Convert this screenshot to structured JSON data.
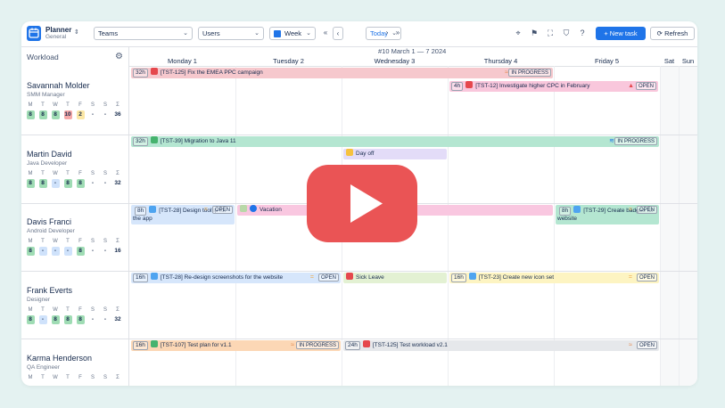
{
  "app": {
    "name": "Planner",
    "sub": "General"
  },
  "toolbar": {
    "teams": "Teams",
    "users": "Users",
    "week": "Week",
    "today": "Today",
    "new_task": "+ New task",
    "refresh": "Refresh"
  },
  "workload_label": "Workload",
  "week_label": "#10 March 1 — 7 2024",
  "days": [
    "Monday 1",
    "Tuesday 2",
    "Wednesday 3",
    "Thursday 4",
    "Friday 5",
    "Sat",
    "Sun"
  ],
  "day_letters": [
    "M",
    "T",
    "W",
    "T",
    "F",
    "S",
    "S",
    "Σ"
  ],
  "people": [
    {
      "name": "Savannah Molder",
      "role": "SMM Manager",
      "values": [
        "8",
        "8",
        "8",
        "10",
        "2",
        "-",
        "-",
        "36"
      ]
    },
    {
      "name": "Martin David",
      "role": "Java Developer",
      "values": [
        "8",
        "8",
        "-",
        "8",
        "8",
        "-",
        "-",
        "32"
      ]
    },
    {
      "name": "Davis Franci",
      "role": "Android Developer",
      "values": [
        "8",
        "-",
        "-",
        "-",
        "8",
        "-",
        "-",
        "16"
      ]
    },
    {
      "name": "Frank Everts",
      "role": "Designer",
      "values": [
        "8",
        "-",
        "8",
        "8",
        "8",
        "-",
        "-",
        "32"
      ]
    },
    {
      "name": "Karma Henderson",
      "role": "QA Engineer",
      "values": [
        "M",
        "T",
        "W",
        "T",
        "F",
        "S",
        "S",
        "Σ"
      ]
    }
  ],
  "tasks": {
    "t1": {
      "est": "32h",
      "text": "[TST-125] Fix the EMEA PPC campaign",
      "status": "IN PROGRESS"
    },
    "t2": {
      "est": "4h",
      "text": "[TST-12] Investigate higher CPC in February",
      "status": "OPEN"
    },
    "t3": {
      "est": "32h",
      "text": "[TST-39] Migration to Java 11",
      "status": "IN PROGRESS"
    },
    "t4": {
      "text": "Day off"
    },
    "t5": {
      "est": "8h",
      "text": "[TST-28] Design tooltip for the app",
      "status": "OPEN"
    },
    "t6": {
      "text": "Vacation"
    },
    "t7": {
      "est": "8h",
      "text": "[TST-29] Create badges for website",
      "status": "OPEN"
    },
    "t8": {
      "est": "16h",
      "text": "[TST-28] Re-design screenshots for the website",
      "status": "OPEN"
    },
    "t9": {
      "text": "Sick Leave"
    },
    "t10": {
      "est": "16h",
      "text": "[TST-23] Create new icon set",
      "status": "OPEN"
    },
    "t11": {
      "est": "16h",
      "text": "[TST-107] Test plan for v1.1",
      "status": "IN PROGRESS"
    },
    "t12": {
      "est": "24h",
      "text": "[TST-125] Test workload v2.1",
      "status": "OPEN"
    }
  },
  "colors": {
    "accent": "#1f74e8",
    "play": "#ea5455"
  }
}
